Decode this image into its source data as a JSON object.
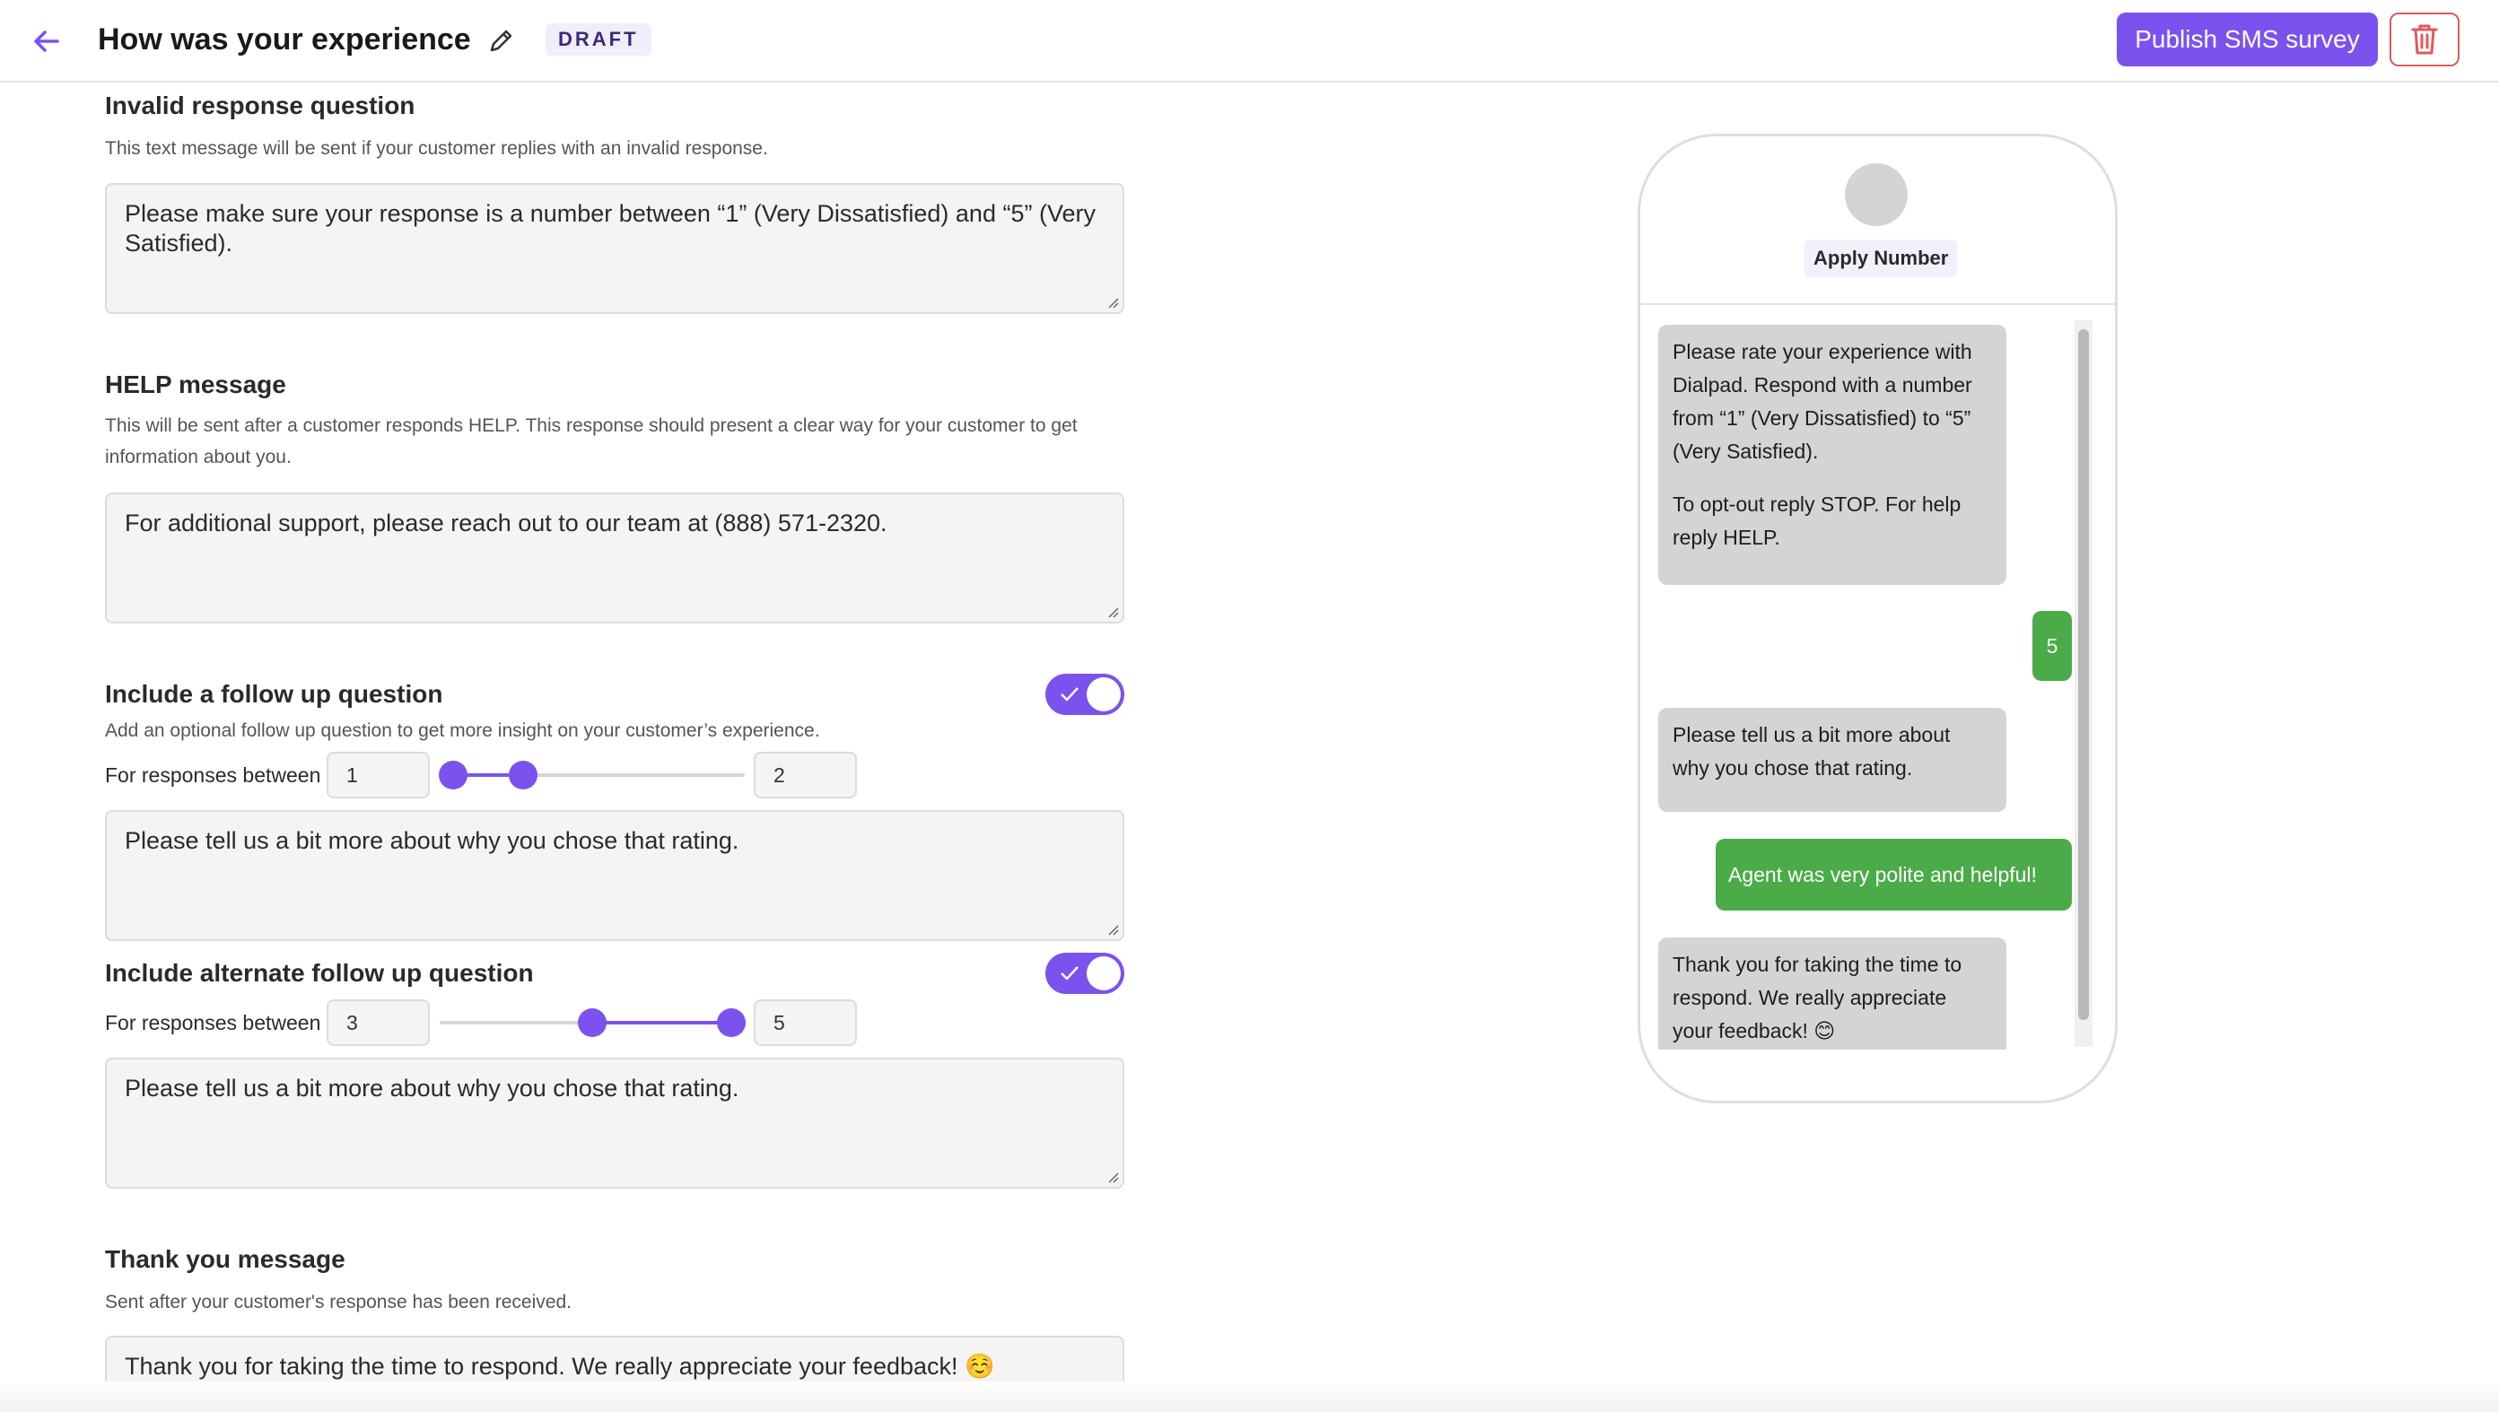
{
  "header": {
    "title": "How was your experience",
    "status_badge": "DRAFT",
    "publish_label": "Publish SMS survey"
  },
  "colors": {
    "accent": "#7c52ee",
    "danger": "#e05a5a",
    "outgoing_bubble": "#4bab48",
    "incoming_bubble": "#d4d4d4"
  },
  "invalid_response": {
    "title": "Invalid response question",
    "description": "This text message will be sent if your customer replies with an invalid response.",
    "value": "Please make sure your response is a number between “1” (Very Dissatisfied) and “5” (Very Satisfied)."
  },
  "help_message": {
    "title": "HELP message",
    "description": "This will be sent after a customer responds HELP. This response should present a clear way for your customer to get information about you.",
    "value": "For additional support, please reach out to our team at (888) 571-2320."
  },
  "follow_up": {
    "title": "Include a follow up question",
    "description": "Add an optional follow up question to get more insight on your customer’s experience.",
    "enabled": true,
    "range_label": "For responses between",
    "min": "1",
    "max": "2",
    "value": "Please tell us a bit more about why you chose that rating."
  },
  "alternate_follow_up": {
    "title": "Include alternate follow up question",
    "enabled": true,
    "range_label": "For responses between",
    "min": "3",
    "max": "5",
    "value": "Please tell us a bit more about why you chose that rating."
  },
  "thank_you": {
    "title": "Thank you message",
    "description": "Sent after your customer's response has been received.",
    "value": "Thank you for taking the time to respond. We really appreciate your feedback! ☺️"
  },
  "preview": {
    "number_label": "Apply Number",
    "messages": [
      {
        "direction": "in",
        "text": "Please rate your experience with Dialpad. Respond with a number from “1” (Very Dissatisfied) to “5” (Very Satisfied).",
        "text2": "To opt-out reply STOP. For help reply HELP."
      },
      {
        "direction": "out",
        "text": "5"
      },
      {
        "direction": "in",
        "text": "Please tell us a bit more about why you chose that rating."
      },
      {
        "direction": "out",
        "text": "Agent was very polite and helpful!"
      },
      {
        "direction": "in",
        "text": "Thank you for taking the time to respond. We really appreciate your feedback! 😊"
      }
    ]
  }
}
